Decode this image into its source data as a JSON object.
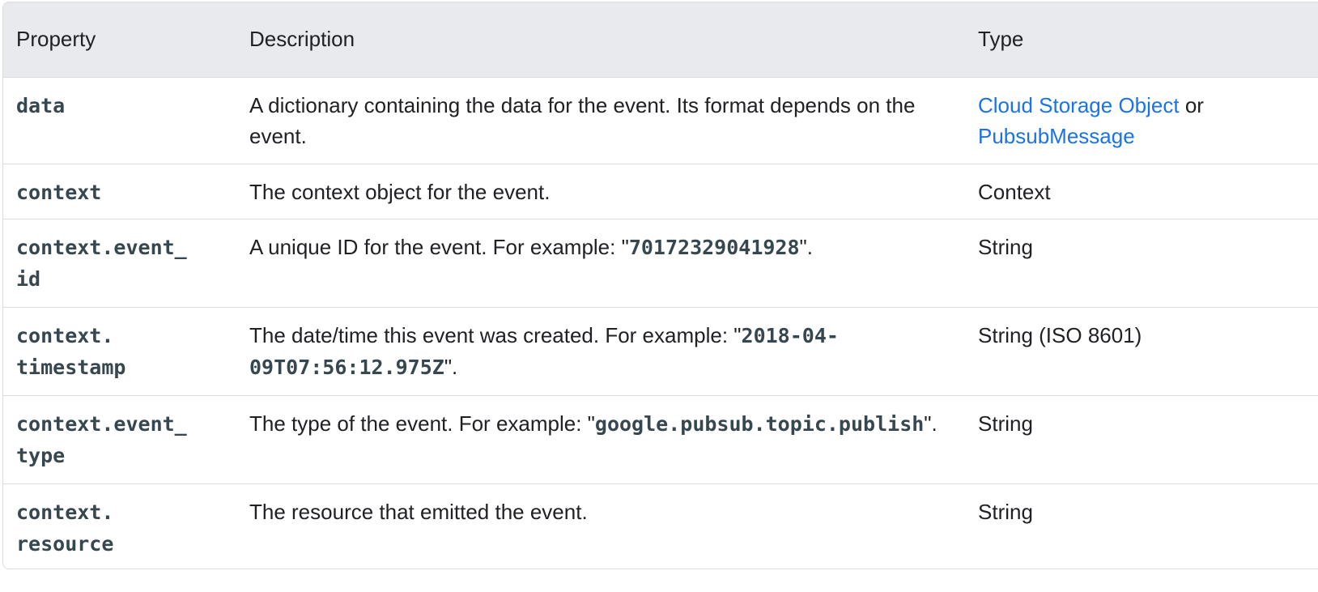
{
  "headers": {
    "property": "Property",
    "description": "Description",
    "type": "Type"
  },
  "rows": [
    {
      "property": "data",
      "desc_text": "A dictionary containing the data for the event. Its format depends on the event.",
      "type_link1": "Cloud Storage Object",
      "type_sep": " or ",
      "type_link2": "PubsubMessage"
    },
    {
      "property": "context",
      "desc_text": "The context object for the event.",
      "type": "Context"
    },
    {
      "property_line1": "context.event_",
      "property_line2": "id",
      "desc_pre": "A unique ID for the event. For example: \"",
      "desc_code": "70172329041928",
      "desc_post": "\".",
      "type": "String"
    },
    {
      "property_line1": "context.",
      "property_line2": "timestamp",
      "desc_pre": "The date/time this event was created. For example: \"",
      "desc_code": "2018-04-09T07:56:12.975Z",
      "desc_post": "\".",
      "type": "String (ISO 8601)"
    },
    {
      "property_line1": "context.event_",
      "property_line2": "type",
      "desc_pre": "The type of the event. For example: \"",
      "desc_code": "google.pubsub.topic.publish",
      "desc_post": "\".",
      "type": "String"
    },
    {
      "property_line1": "context.",
      "property_line2": "resource",
      "desc_text": "The resource that emitted the event.",
      "type": "String"
    }
  ],
  "colors": {
    "header_bg": "#e8eaed",
    "link": "#1a73e8",
    "code": "#37474f",
    "border": "#dadce0"
  }
}
